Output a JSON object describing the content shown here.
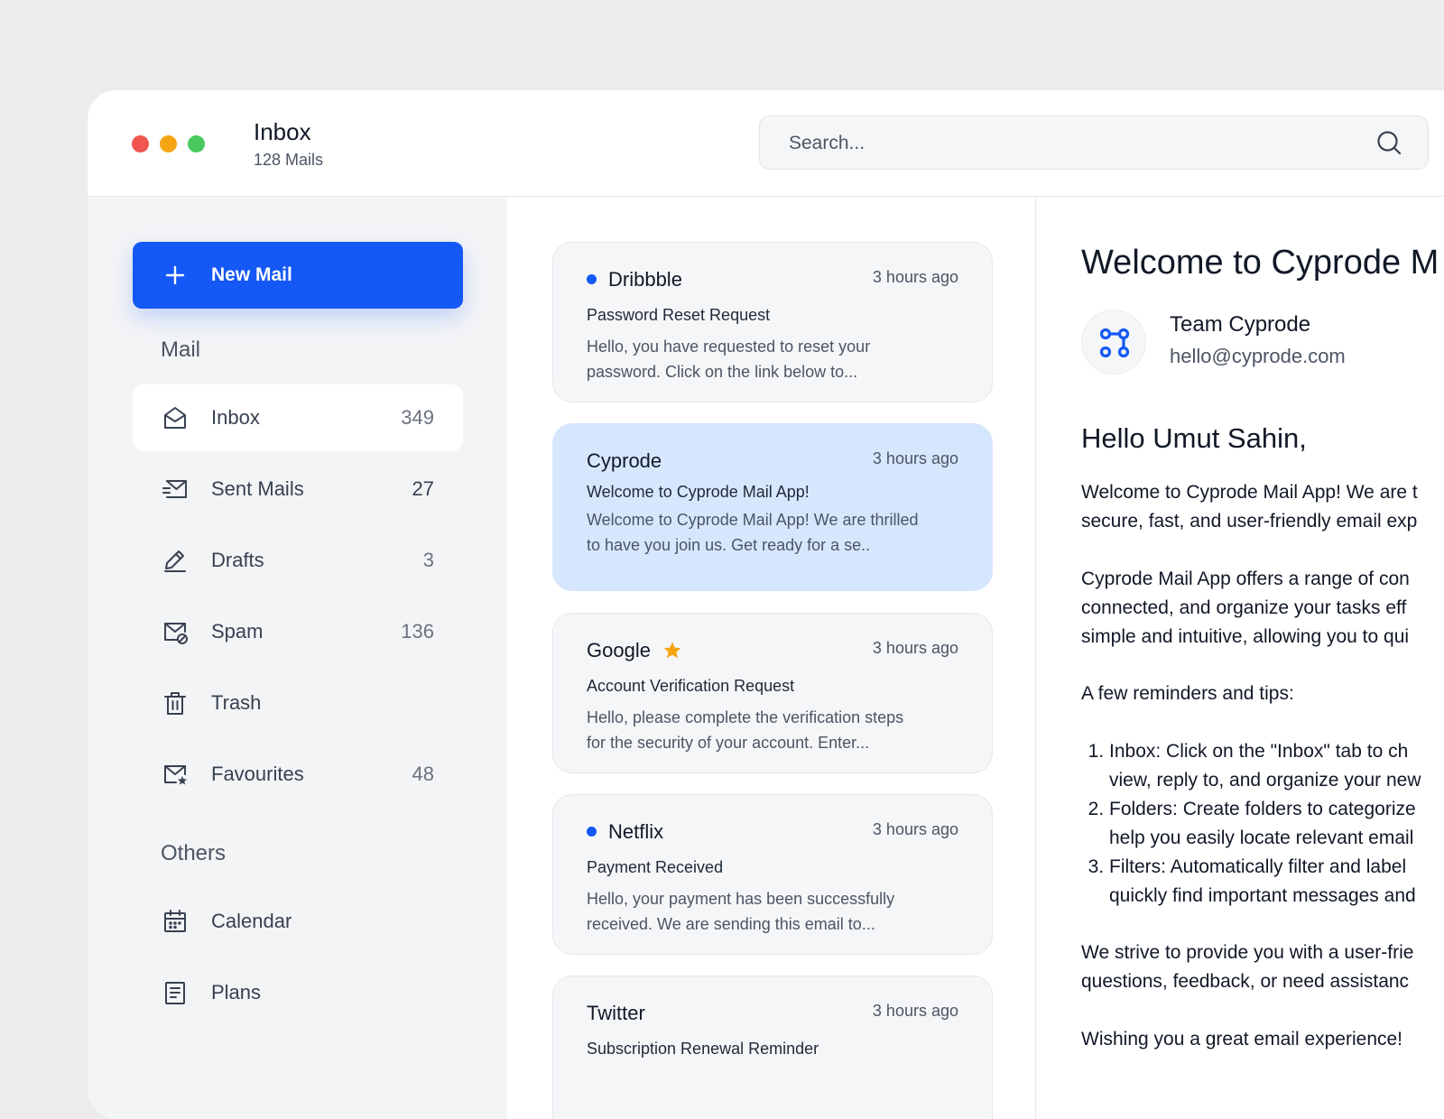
{
  "titlebar": {
    "title": "Inbox",
    "subtitle": "128 Mails"
  },
  "search": {
    "placeholder": "Search..."
  },
  "sidebar": {
    "new_mail_label": "New Mail",
    "mail_section": "Mail",
    "others_section": "Others",
    "mail_items": [
      {
        "label": "Inbox",
        "count": "349",
        "icon": "inbox-icon",
        "active": true
      },
      {
        "label": "Sent Mails",
        "count": "27",
        "icon": "sent-icon"
      },
      {
        "label": "Drafts",
        "count": "3",
        "icon": "pencil-icon"
      },
      {
        "label": "Spam",
        "count": "136",
        "icon": "spam-icon"
      },
      {
        "label": "Trash",
        "count": "",
        "icon": "trash-icon"
      },
      {
        "label": "Favourites",
        "count": "48",
        "icon": "favourite-mail-icon"
      }
    ],
    "other_items": [
      {
        "label": "Calendar",
        "icon": "calendar-icon"
      },
      {
        "label": "Plans",
        "icon": "plans-icon"
      }
    ]
  },
  "mails": [
    {
      "sender": "Dribbble",
      "time": "3 hours ago",
      "subject": "Password Reset Request",
      "preview_line1": "Hello, you have requested to reset your",
      "preview_line2": "password. Click on the link below to...",
      "unread": true,
      "starred": false,
      "selected": false
    },
    {
      "sender": "Cyprode",
      "time": "3 hours ago",
      "subject": "Welcome to Cyprode Mail App!",
      "preview_line1": "Welcome to Cyprode Mail App! We are thrilled",
      "preview_line2": "to have you join us. Get ready for a se..",
      "unread": false,
      "starred": false,
      "selected": true
    },
    {
      "sender": "Google",
      "time": "3 hours ago",
      "subject": "Account Verification Request",
      "preview_line1": "Hello, please complete the verification steps",
      "preview_line2": "for the security of your account. Enter...",
      "unread": false,
      "starred": true,
      "selected": false
    },
    {
      "sender": "Netflix",
      "time": "3 hours ago",
      "subject": "Payment Received",
      "preview_line1": "Hello, your payment has been successfully",
      "preview_line2": "received. We are sending this email to...",
      "unread": true,
      "starred": false,
      "selected": false
    },
    {
      "sender": "Twitter",
      "time": "3 hours ago",
      "subject": "Subscription Renewal Reminder",
      "preview_line1": "",
      "preview_line2": "",
      "unread": false,
      "starred": false,
      "selected": false
    }
  ],
  "reader": {
    "title": "Welcome to Cyprode M",
    "from_name": "Team Cyprode",
    "from_email": "hello@cyprode.com",
    "greeting": "Hello Umut Sahin,",
    "p1_line1": "Welcome to Cyprode Mail App! We are t",
    "p1_line2": "secure, fast, and user-friendly email exp",
    "p2_line1": "Cyprode Mail App offers a range of con",
    "p2_line2": "connected, and organize your tasks eff",
    "p2_line3": "simple and intuitive, allowing you to qui",
    "tips_intro": "A few reminders and tips:",
    "tip1_line1": "Inbox: Click on the \"Inbox\" tab to ch",
    "tip1_line2": "view, reply to, and organize your new",
    "tip2_line1": "Folders: Create folders to categorize",
    "tip2_line2": "help you easily locate relevant email",
    "tip3_line1": "Filters: Automatically filter and label",
    "tip3_line2": "quickly find important messages and",
    "p3_line1": "We strive to provide you with a user-frie",
    "p3_line2": "questions, feedback, or need assistanc",
    "closing": "Wishing you a great email experience!"
  },
  "colors": {
    "accent": "#1458f5",
    "selected_card": "#d6e6fc",
    "star": "#f5a514",
    "traffic_red": "#f0554f",
    "traffic_yellow": "#f5a514",
    "traffic_green": "#49c95e"
  }
}
